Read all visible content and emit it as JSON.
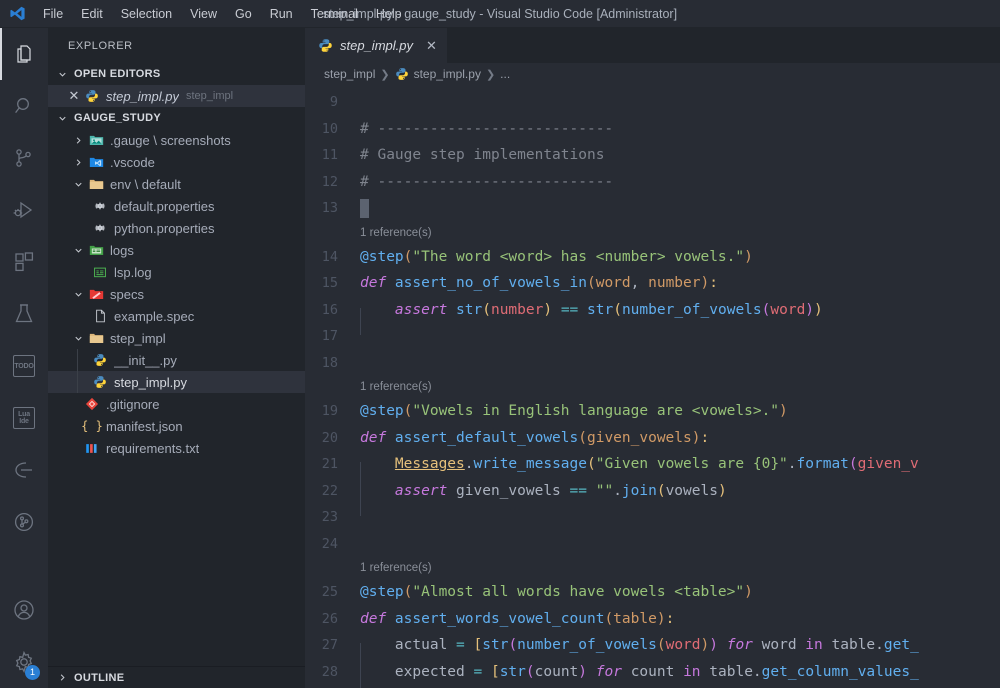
{
  "titlebar": {
    "logo_icon": "vscode-logo-icon",
    "window_title": "step_impl.py - gauge_study - Visual Studio Code [Administrator]",
    "menus": [
      "File",
      "Edit",
      "Selection",
      "View",
      "Go",
      "Run",
      "Terminal",
      "Help"
    ]
  },
  "activitybar": {
    "items": [
      {
        "name": "explorer",
        "icon": "files-icon",
        "active": true,
        "badge": ""
      },
      {
        "name": "search",
        "icon": "search-icon",
        "active": false,
        "badge": ""
      },
      {
        "name": "source-control",
        "icon": "source-control-icon",
        "active": false,
        "badge": ""
      },
      {
        "name": "run-and-debug",
        "icon": "run-debug-icon",
        "active": false,
        "badge": ""
      },
      {
        "name": "extensions",
        "icon": "extensions-icon",
        "active": false,
        "badge": ""
      },
      {
        "name": "testing",
        "icon": "beaker-icon",
        "active": false,
        "badge": ""
      },
      {
        "name": "todo-tree",
        "icon": "todo-icon",
        "label": "TODO",
        "active": false,
        "badge": ""
      },
      {
        "name": "lua-ide",
        "icon": "lua-ide-icon",
        "label": "Lua\nIde",
        "active": false,
        "badge": ""
      },
      {
        "name": "gauge",
        "icon": "gauge-icon",
        "active": false,
        "badge": ""
      },
      {
        "name": "timeline",
        "icon": "git-graph-icon",
        "active": false,
        "badge": ""
      }
    ],
    "bottom_items": [
      {
        "name": "accounts",
        "icon": "account-icon",
        "badge": ""
      },
      {
        "name": "manage-settings",
        "icon": "gear-icon",
        "badge": "1"
      }
    ],
    "badge_color": "#2a7fd4"
  },
  "sidebar": {
    "title": "EXPLORER",
    "open_editors": {
      "header": "OPEN EDITORS",
      "expanded": true,
      "items": [
        {
          "close_icon": "close-icon",
          "icon": "python-icon",
          "name": "step_impl.py",
          "folder": "step_impl",
          "active": true
        }
      ]
    },
    "workspace": {
      "header": "GAUGE_STUDY",
      "expanded": true,
      "items": [
        {
          "depth": 1,
          "twisty": "collapsed",
          "icon": "images-folder-icon",
          "label": ".gauge \\ screenshots",
          "selected": false
        },
        {
          "depth": 1,
          "twisty": "collapsed",
          "icon": "vscode-folder-icon",
          "label": ".vscode",
          "selected": false
        },
        {
          "depth": 1,
          "twisty": "expanded",
          "icon": "folder-icon",
          "label": "env \\ default",
          "selected": false
        },
        {
          "depth": 2,
          "twisty": "none",
          "icon": "gear-file-icon",
          "label": "default.properties",
          "selected": false
        },
        {
          "depth": 2,
          "twisty": "none",
          "icon": "gear-file-icon",
          "label": "python.properties",
          "selected": false
        },
        {
          "depth": 1,
          "twisty": "expanded",
          "icon": "logs-folder-icon",
          "label": "logs",
          "selected": false
        },
        {
          "depth": 2,
          "twisty": "none",
          "icon": "log-file-icon",
          "label": "lsp.log",
          "selected": false
        },
        {
          "depth": 1,
          "twisty": "expanded",
          "icon": "specs-folder-icon",
          "label": "specs",
          "selected": false
        },
        {
          "depth": 2,
          "twisty": "none",
          "icon": "file-icon",
          "label": "example.spec",
          "selected": false
        },
        {
          "depth": 1,
          "twisty": "expanded",
          "icon": "folder-icon",
          "label": "step_impl",
          "selected": false
        },
        {
          "depth": 2,
          "twisty": "none",
          "icon": "python-icon",
          "label": "__init__.py",
          "selected": false
        },
        {
          "depth": 2,
          "twisty": "none",
          "icon": "python-icon",
          "label": "step_impl.py",
          "selected": true
        },
        {
          "depth": 1,
          "twisty": "none",
          "icon": "git-icon",
          "label": ".gitignore",
          "selected": false
        },
        {
          "depth": 1,
          "twisty": "none",
          "icon": "json-icon",
          "label": "manifest.json",
          "selected": false
        },
        {
          "depth": 1,
          "twisty": "none",
          "icon": "txt-icon",
          "label": "requirements.txt",
          "selected": false
        }
      ]
    },
    "outline": {
      "header": "OUTLINE",
      "expanded": false
    }
  },
  "editor": {
    "tabs": [
      {
        "icon": "python-icon",
        "label": "step_impl.py",
        "close_icon": "close-icon",
        "active": true
      }
    ],
    "breadcrumbs": [
      "step_impl",
      "step_impl.py",
      "..."
    ],
    "breadcrumb_file_icon": "python-icon",
    "lines": [
      {
        "num": "9",
        "tokens": []
      },
      {
        "num": "10",
        "tokens": [
          {
            "c": "t-com",
            "t": "# ---------------------------"
          }
        ]
      },
      {
        "num": "11",
        "tokens": [
          {
            "c": "t-com",
            "t": "# Gauge step implementations"
          }
        ]
      },
      {
        "num": "12",
        "tokens": [
          {
            "c": "t-com",
            "t": "# ---------------------------"
          }
        ]
      },
      {
        "num": "13",
        "tokens": [
          {
            "c": "cursor",
            "t": ""
          }
        ]
      },
      {
        "codelens": "1 reference(s)"
      },
      {
        "num": "14",
        "tokens": [
          {
            "c": "t-dec",
            "t": "@step"
          },
          {
            "c": "t-br1",
            "t": "("
          },
          {
            "c": "t-str",
            "t": "\"The word <word> has <number> vowels.\""
          },
          {
            "c": "t-br1",
            "t": ")"
          }
        ]
      },
      {
        "num": "15",
        "tokens": [
          {
            "c": "t-kwi",
            "t": "def "
          },
          {
            "c": "t-fn",
            "t": "assert_no_of_vowels_in"
          },
          {
            "c": "t-br1",
            "t": "("
          },
          {
            "c": "t-par",
            "t": "word"
          },
          {
            "c": "t-pl",
            "t": ", "
          },
          {
            "c": "t-par",
            "t": "number"
          },
          {
            "c": "t-br1",
            "t": ")"
          },
          {
            "c": "t-br3",
            "t": ":"
          }
        ]
      },
      {
        "num": "16",
        "indent": 1,
        "tokens": [
          {
            "c": "t-kwi",
            "t": "    assert "
          },
          {
            "c": "t-fn",
            "t": "str"
          },
          {
            "c": "t-br3",
            "t": "("
          },
          {
            "c": "t-var",
            "t": "number"
          },
          {
            "c": "t-br3",
            "t": ")"
          },
          {
            "c": "t-op",
            "t": " == "
          },
          {
            "c": "t-fn",
            "t": "str"
          },
          {
            "c": "t-br3",
            "t": "("
          },
          {
            "c": "t-fn",
            "t": "number_of_vowels"
          },
          {
            "c": "t-br2",
            "t": "("
          },
          {
            "c": "t-var",
            "t": "word"
          },
          {
            "c": "t-br2",
            "t": ")"
          },
          {
            "c": "t-br3",
            "t": ")"
          }
        ]
      },
      {
        "num": "17",
        "tokens": []
      },
      {
        "num": "18",
        "tokens": []
      },
      {
        "codelens": "1 reference(s)"
      },
      {
        "num": "19",
        "tokens": [
          {
            "c": "t-dec",
            "t": "@step"
          },
          {
            "c": "t-br1",
            "t": "("
          },
          {
            "c": "t-str",
            "t": "\"Vowels in English language are <vowels>.\""
          },
          {
            "c": "t-br1",
            "t": ")"
          }
        ]
      },
      {
        "num": "20",
        "tokens": [
          {
            "c": "t-kwi",
            "t": "def "
          },
          {
            "c": "t-fn",
            "t": "assert_default_vowels"
          },
          {
            "c": "t-br1",
            "t": "("
          },
          {
            "c": "t-par",
            "t": "given_vowels"
          },
          {
            "c": "t-br1",
            "t": ")"
          },
          {
            "c": "t-br3",
            "t": ":"
          }
        ]
      },
      {
        "num": "21",
        "indent": 1,
        "tokens": [
          {
            "c": "t-pl",
            "t": "    "
          },
          {
            "c": "t-cls",
            "t": "Messages"
          },
          {
            "c": "t-pl",
            "t": "."
          },
          {
            "c": "t-fn",
            "t": "write_message"
          },
          {
            "c": "t-br3",
            "t": "("
          },
          {
            "c": "t-str",
            "t": "\"Given vowels are {0}\""
          },
          {
            "c": "t-pl",
            "t": "."
          },
          {
            "c": "t-fn",
            "t": "format"
          },
          {
            "c": "t-br2",
            "t": "("
          },
          {
            "c": "t-var",
            "t": "given_v"
          }
        ]
      },
      {
        "num": "22",
        "indent": 1,
        "tokens": [
          {
            "c": "t-kwi",
            "t": "    assert "
          },
          {
            "c": "t-pl",
            "t": "given_vowels"
          },
          {
            "c": "t-op",
            "t": " == "
          },
          {
            "c": "t-str",
            "t": "\"\""
          },
          {
            "c": "t-pl",
            "t": "."
          },
          {
            "c": "t-fn",
            "t": "join"
          },
          {
            "c": "t-br3",
            "t": "("
          },
          {
            "c": "t-pl",
            "t": "vowels"
          },
          {
            "c": "t-br3",
            "t": ")"
          }
        ]
      },
      {
        "num": "23",
        "tokens": []
      },
      {
        "num": "24",
        "tokens": []
      },
      {
        "codelens": "1 reference(s)"
      },
      {
        "num": "25",
        "tokens": [
          {
            "c": "t-dec",
            "t": "@step"
          },
          {
            "c": "t-br1",
            "t": "("
          },
          {
            "c": "t-str",
            "t": "\"Almost all words have vowels <table>\""
          },
          {
            "c": "t-br1",
            "t": ")"
          }
        ]
      },
      {
        "num": "26",
        "tokens": [
          {
            "c": "t-kwi",
            "t": "def "
          },
          {
            "c": "t-fn",
            "t": "assert_words_vowel_count"
          },
          {
            "c": "t-br1",
            "t": "("
          },
          {
            "c": "t-par",
            "t": "table"
          },
          {
            "c": "t-br1",
            "t": ")"
          },
          {
            "c": "t-br3",
            "t": ":"
          }
        ]
      },
      {
        "num": "27",
        "indent": 1,
        "tokens": [
          {
            "c": "t-pl",
            "t": "    actual "
          },
          {
            "c": "t-op",
            "t": "= "
          },
          {
            "c": "t-br3",
            "t": "["
          },
          {
            "c": "t-fn",
            "t": "str"
          },
          {
            "c": "t-br2",
            "t": "("
          },
          {
            "c": "t-fn",
            "t": "number_of_vowels"
          },
          {
            "c": "t-br1",
            "t": "("
          },
          {
            "c": "t-var",
            "t": "word"
          },
          {
            "c": "t-br1",
            "t": ")"
          },
          {
            "c": "t-br2",
            "t": ")"
          },
          {
            "c": "t-kwi",
            "t": " for "
          },
          {
            "c": "t-pl",
            "t": "word "
          },
          {
            "c": "t-kw",
            "t": "in "
          },
          {
            "c": "t-pl",
            "t": "table."
          },
          {
            "c": "t-fn",
            "t": "get_"
          }
        ]
      },
      {
        "num": "28",
        "indent": 1,
        "tokens": [
          {
            "c": "t-pl",
            "t": "    expected "
          },
          {
            "c": "t-op",
            "t": "= "
          },
          {
            "c": "t-br3",
            "t": "["
          },
          {
            "c": "t-fn",
            "t": "str"
          },
          {
            "c": "t-br2",
            "t": "("
          },
          {
            "c": "t-pl",
            "t": "count"
          },
          {
            "c": "t-br2",
            "t": ")"
          },
          {
            "c": "t-kwi",
            "t": " for "
          },
          {
            "c": "t-pl",
            "t": "count "
          },
          {
            "c": "t-kw",
            "t": "in "
          },
          {
            "c": "t-pl",
            "t": "table."
          },
          {
            "c": "t-fn",
            "t": "get_column_values_"
          }
        ]
      }
    ]
  },
  "colors": {
    "editor_bg": "#282c34",
    "sidebar_bg": "#21252b",
    "accent": "#2a7fd4",
    "selection_bg": "#2f333d"
  }
}
